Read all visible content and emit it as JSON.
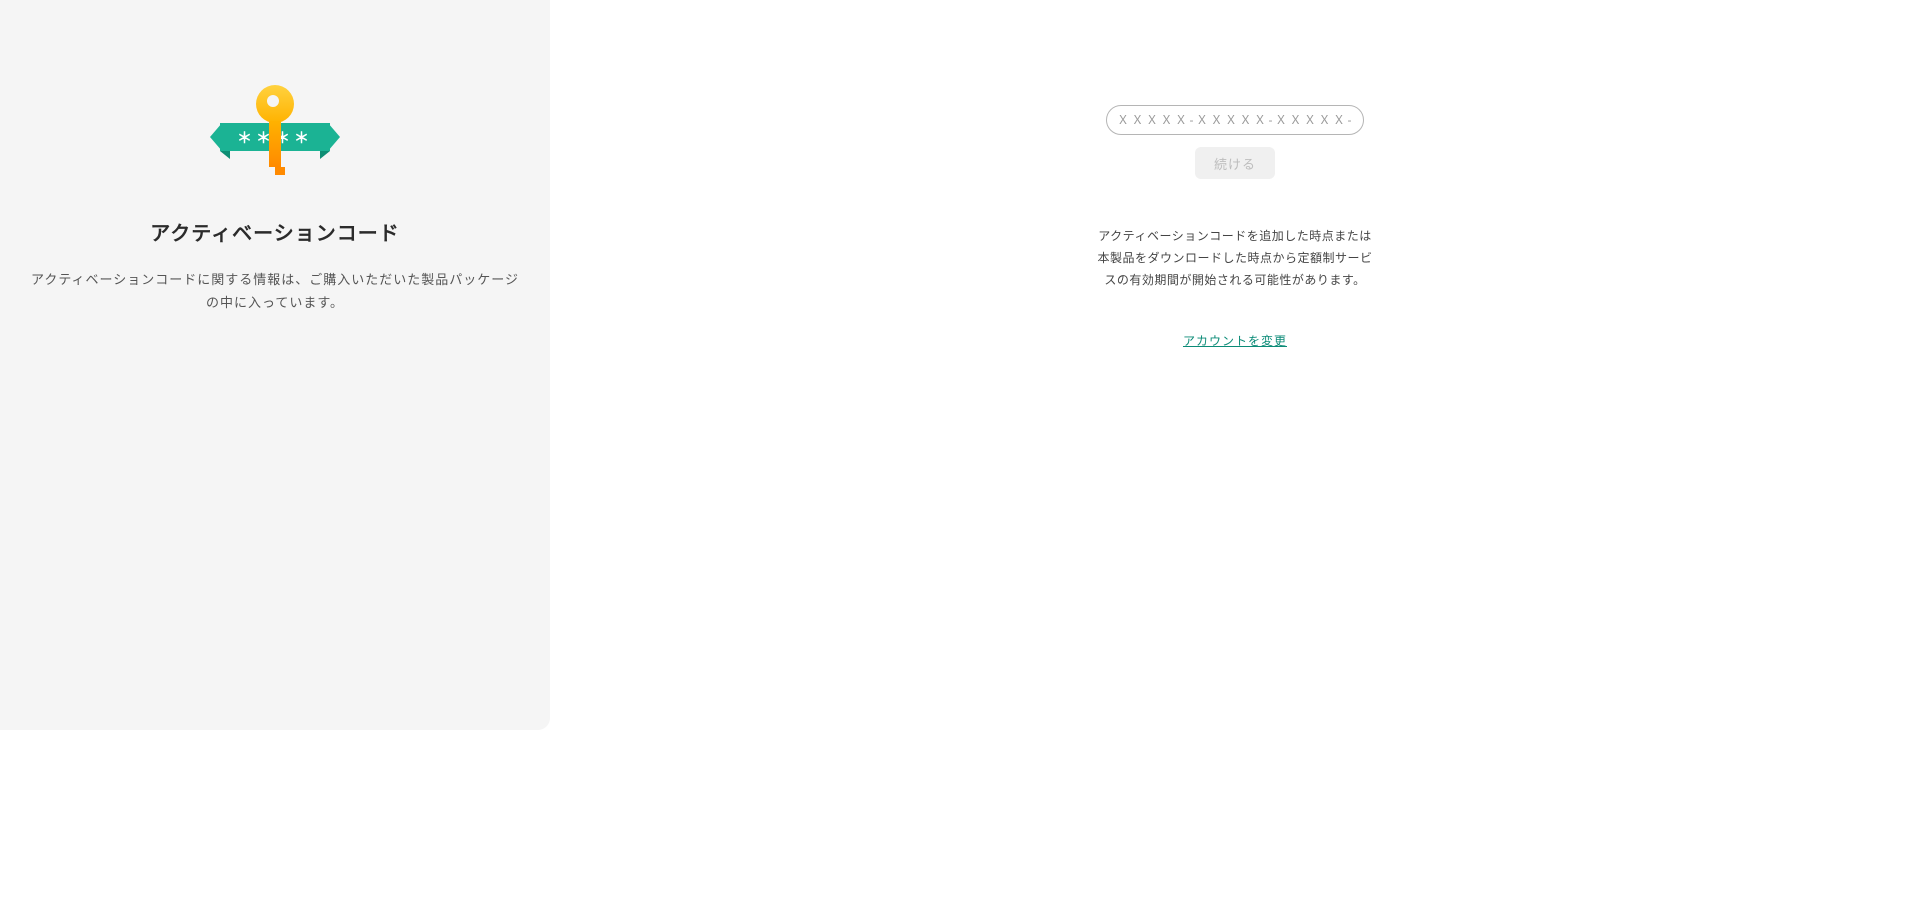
{
  "left": {
    "title": "アクティベーションコード",
    "description_line1": "アクティベーションコードに関する情報は、ご購入いただいた製品パッケージ",
    "description_line2": "の中に入っています。",
    "ribbon_stars": "＊＊＊＊"
  },
  "right": {
    "code_placeholder": "ＸＸＸＸＸ-ＸＸＸＸＸ-ＸＸＸＸＸ-ＸＸＸＸＸ",
    "continue_label": "続ける",
    "notice": "アクティベーションコードを追加した時点または本製品をダウンロードした時点から定額制サービスの有効期間が開始される可能性があります。",
    "change_account_label": "アカウントを変更"
  }
}
